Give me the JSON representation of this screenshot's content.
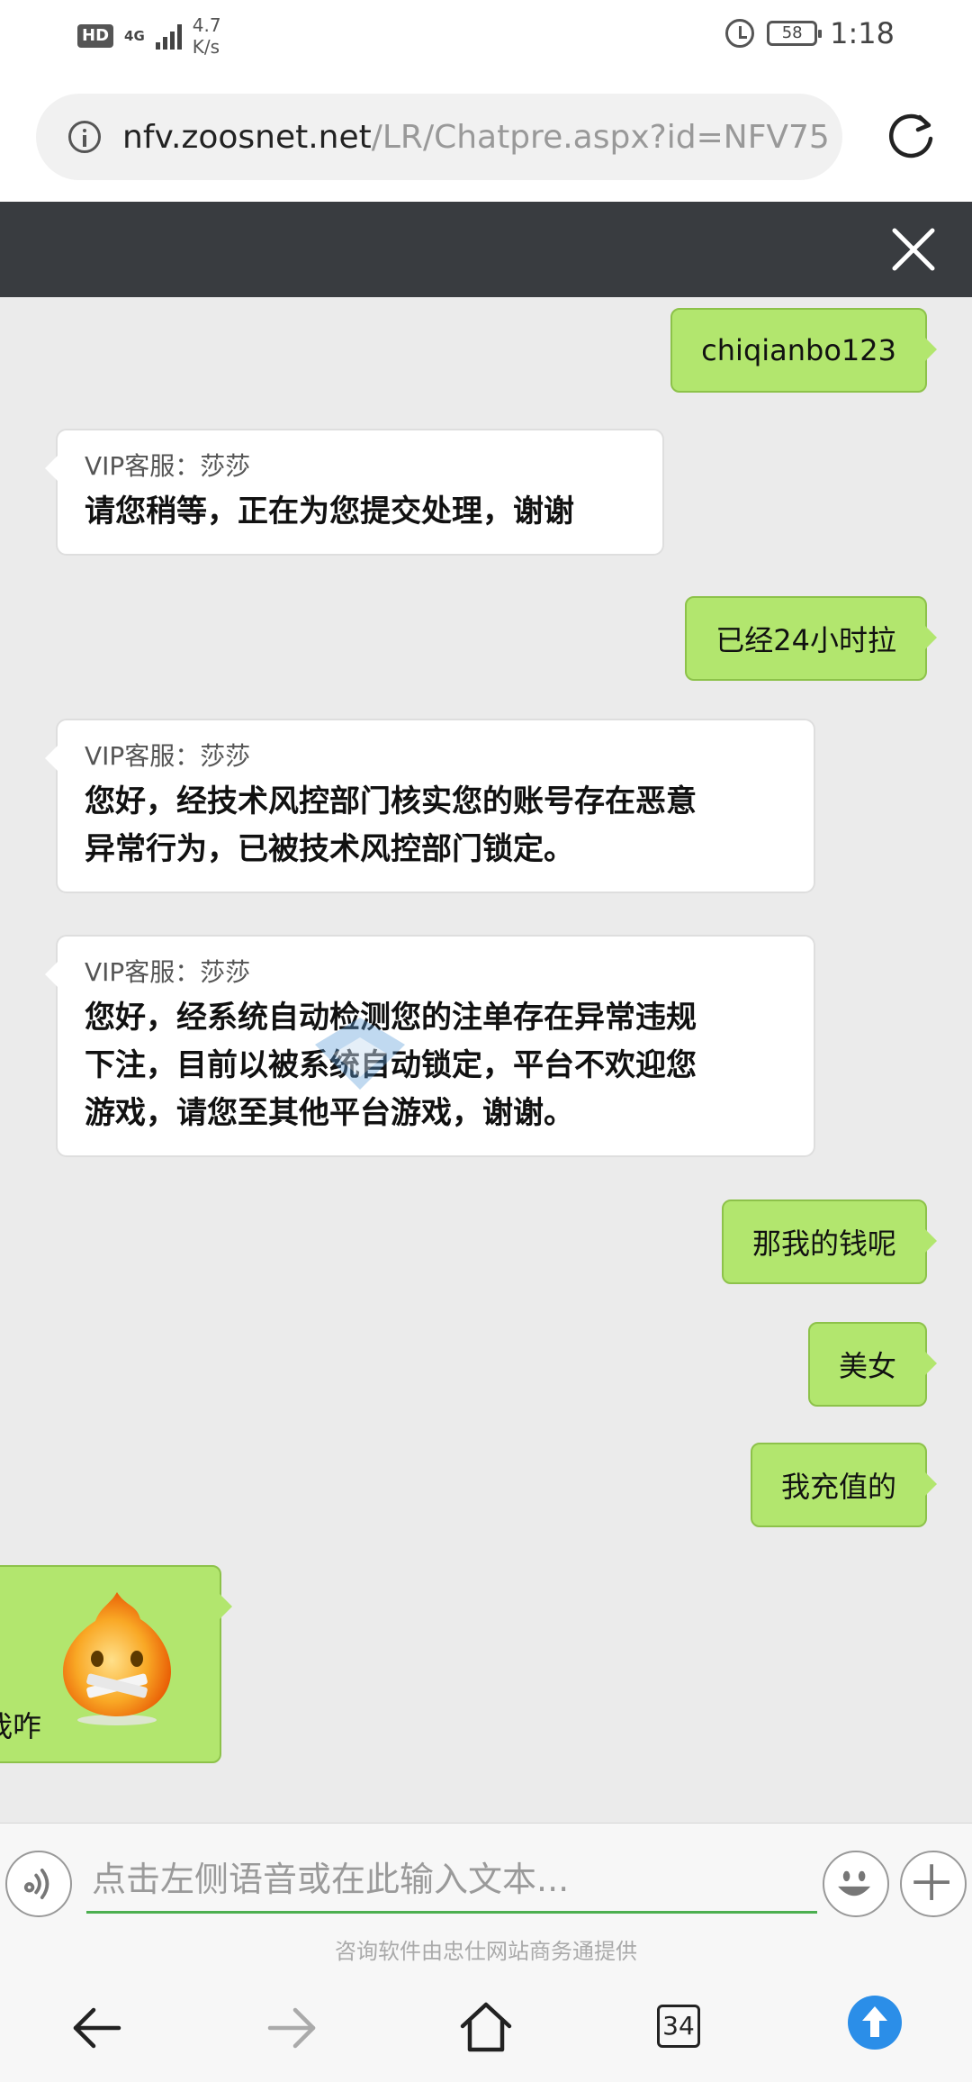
{
  "status_bar": {
    "hd": "HD",
    "network": "4G",
    "speed": "4.7 K/s",
    "battery": "58",
    "time": "1:18"
  },
  "browser": {
    "url_host": "nfv.zoosnet.net",
    "url_path": "/LR/Chatpre.aspx?id=NFV75"
  },
  "chat": {
    "messages": [
      {
        "dir": "out",
        "text": "chiqianbo123"
      },
      {
        "dir": "in",
        "sender": "VIP客服：莎莎",
        "lines": [
          "请您稍等，正在为您提交处理，谢谢"
        ]
      },
      {
        "dir": "out",
        "text": "已经24小时拉"
      },
      {
        "dir": "in",
        "sender": "VIP客服：莎莎",
        "lines": [
          "您好，经技术风控部门核实您的账号存在恶意",
          "异常行为，已被技术风控部门锁定。"
        ]
      },
      {
        "dir": "in",
        "sender": "VIP客服：莎莎",
        "lines": [
          "您好，经系统自动检测您的注单存在异常违规",
          "下注，目前以被系统自动锁定，平台不欢迎您",
          "游戏，请您至其他平台游戏，谢谢。"
        ]
      },
      {
        "dir": "out",
        "text": "那我的钱呢"
      },
      {
        "dir": "out",
        "text": "美女"
      },
      {
        "dir": "out",
        "text": "我充值的"
      },
      {
        "dir": "out",
        "text": "我咋",
        "icon": "mouth-taped-emoji-icon"
      }
    ]
  },
  "input": {
    "placeholder": "点击左侧语音或在此输入文本...",
    "powered_by": "咨询软件由忠仕网站商务通提供"
  },
  "navbar": {
    "tab_count": "34"
  },
  "colors": {
    "outgoing_bubble": "#b2e66e",
    "incoming_bubble": "#ffffff",
    "chat_header": "#393c40",
    "input_underline": "#4caf50",
    "upload_button": "#2b8ee8"
  }
}
